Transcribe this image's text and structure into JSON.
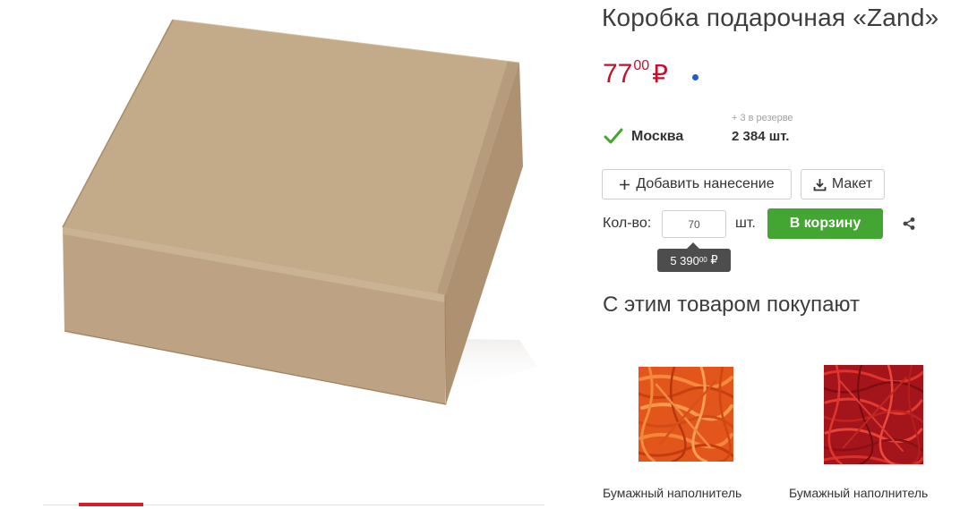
{
  "product": {
    "title": "Коробка подарочная «Zand»",
    "price_int": "77",
    "price_frac": "00",
    "currency": "₽",
    "colors": {
      "price": "#c8102e",
      "dot": "#1f5fc4",
      "accent_green": "#43a532"
    }
  },
  "stock": {
    "city": "Москва",
    "reserve": "+ 3 в резерве",
    "quantity": "2 384 шт."
  },
  "actions": {
    "add_print_label": "Добавить нанесение",
    "maket_label": "Макет",
    "qty_label": "Кол-во:",
    "qty_value": "70",
    "qty_unit": "шт.",
    "cart_label": "В корзину",
    "total_int": "5 390",
    "total_frac": "00",
    "total_currency": "₽"
  },
  "related": {
    "title": "С этим товаром покупают",
    "items": [
      {
        "name": "Бумажный наполнитель",
        "color": "orange"
      },
      {
        "name": "Бумажный наполнитель",
        "color": "red"
      }
    ]
  },
  "icons": [
    "plus-icon",
    "download-icon",
    "check-icon",
    "share-icon"
  ]
}
